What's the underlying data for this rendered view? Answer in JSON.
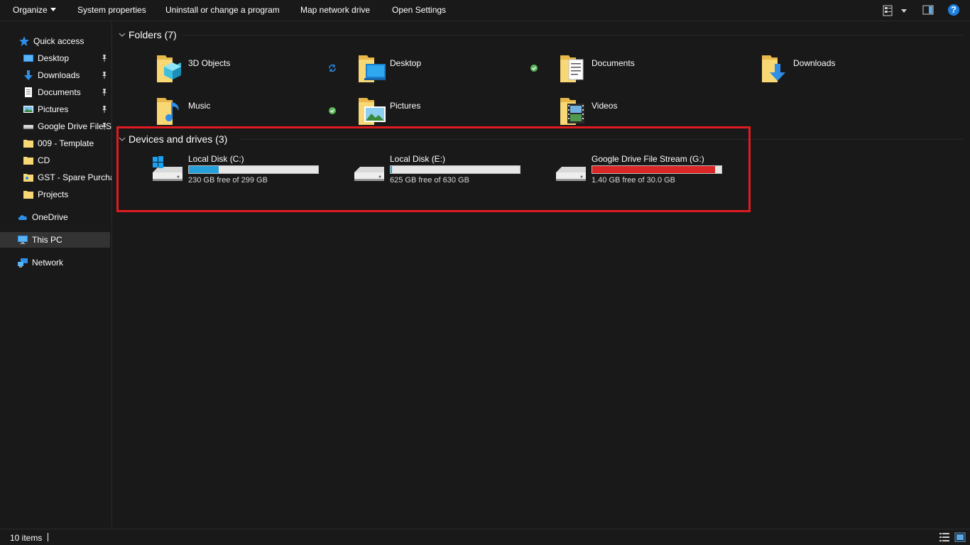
{
  "toolbar": {
    "organize": "Organize",
    "system_properties": "System properties",
    "uninstall": "Uninstall or change a program",
    "map_drive": "Map network drive",
    "open_settings": "Open Settings",
    "help_label": "?"
  },
  "sidebar": {
    "quick_access": "Quick access",
    "items": [
      {
        "label": "Desktop",
        "icon": "desktop-icon",
        "pinned": true
      },
      {
        "label": "Downloads",
        "icon": "downloads-icon",
        "pinned": true
      },
      {
        "label": "Documents",
        "icon": "documents-icon",
        "pinned": true
      },
      {
        "label": "Pictures",
        "icon": "pictures-icon",
        "pinned": true
      },
      {
        "label": "Google Drive File Stream",
        "icon": "drive-icon",
        "pinned": true
      },
      {
        "label": "009 - Template",
        "icon": "folder-icon",
        "pinned": false
      },
      {
        "label": "CD",
        "icon": "folder-icon",
        "pinned": false
      },
      {
        "label": "GST - Spare Purchases",
        "icon": "folder-icon",
        "pinned": false
      },
      {
        "label": "Projects",
        "icon": "folder-icon",
        "pinned": false
      }
    ],
    "onedrive": "OneDrive",
    "this_pc": "This PC",
    "network": "Network"
  },
  "folders_group": {
    "title": "Folders (7)",
    "items": [
      {
        "name": "3D Objects",
        "icon": "3d-objects-folder-icon",
        "status": "sync"
      },
      {
        "name": "Desktop",
        "icon": "desktop-folder-icon",
        "status": "ok"
      },
      {
        "name": "Documents",
        "icon": "documents-folder-icon",
        "status": ""
      },
      {
        "name": "Downloads",
        "icon": "downloads-folder-icon",
        "status": ""
      },
      {
        "name": "Music",
        "icon": "music-folder-icon",
        "status": "ok"
      },
      {
        "name": "Pictures",
        "icon": "pictures-folder-icon",
        "status": ""
      },
      {
        "name": "Videos",
        "icon": "videos-folder-icon",
        "status": ""
      }
    ]
  },
  "drives_group": {
    "title": "Devices and drives (3)",
    "items": [
      {
        "name": "Local Disk (C:)",
        "free": "230 GB free of 299 GB",
        "used_fraction": 0.23,
        "bar_color": "#26a0da",
        "windows": true
      },
      {
        "name": "Local Disk (E:)",
        "free": "625 GB free of 630 GB",
        "used_fraction": 0.01,
        "bar_color": "#26a0da",
        "windows": false
      },
      {
        "name": "Google Drive File Stream (G:)",
        "free": "1.40 GB free of 30.0 GB",
        "used_fraction": 0.95,
        "bar_color": "#da2626",
        "windows": false
      }
    ]
  },
  "status": {
    "count": "10 items"
  },
  "colors": {
    "accent": "#26a0da",
    "warning": "#da2626",
    "highlight": "#e01a22",
    "folder": "#f8d775"
  }
}
